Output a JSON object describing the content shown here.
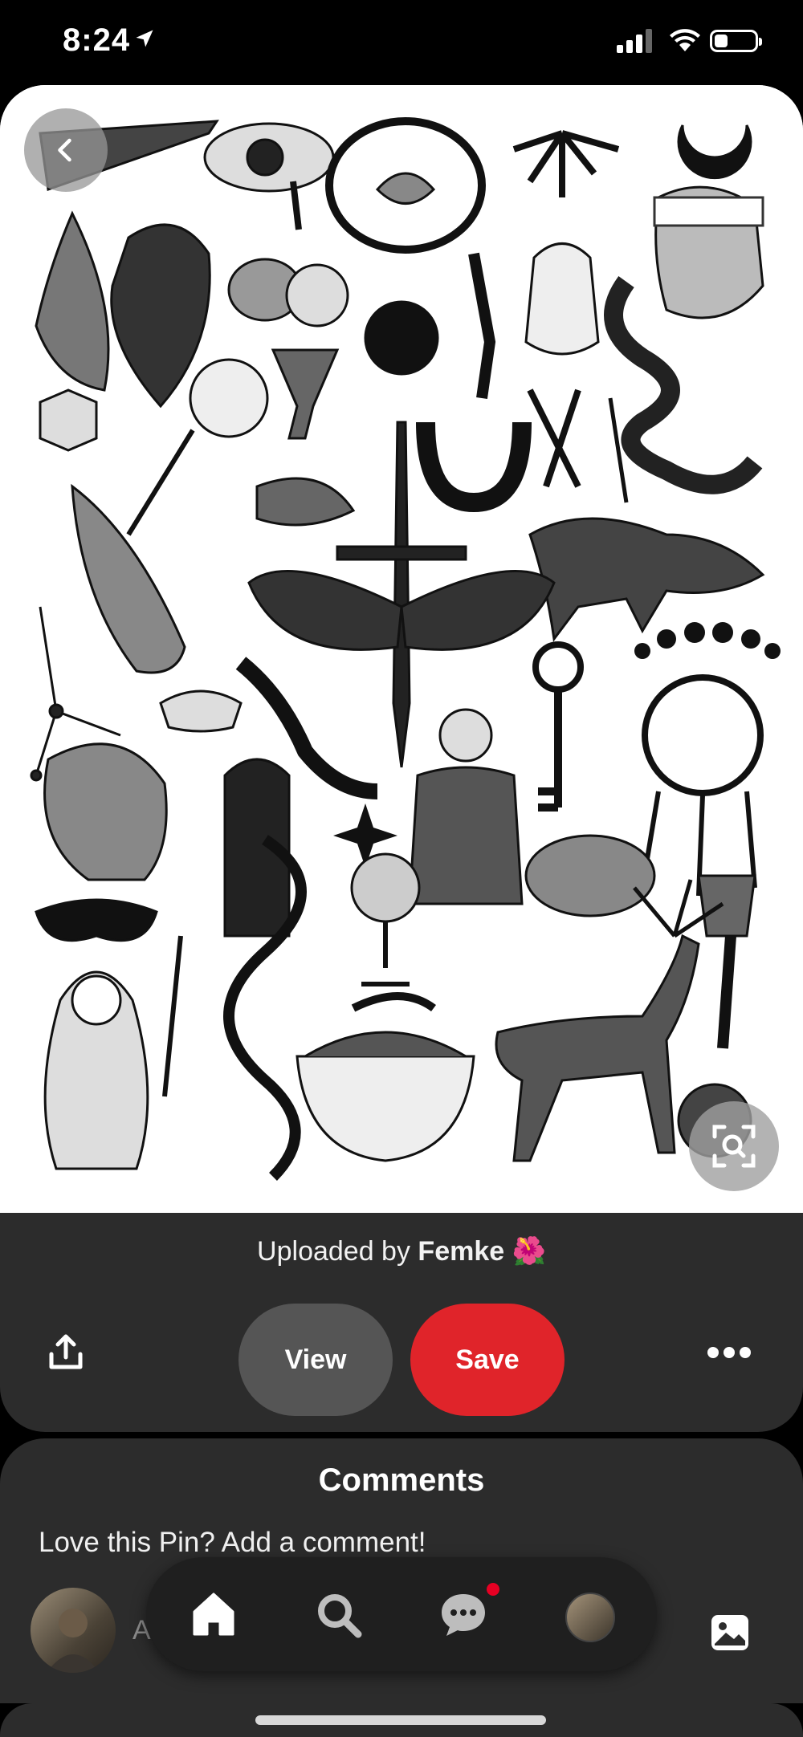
{
  "status_bar": {
    "time": "8:24"
  },
  "pin": {
    "uploaded_prefix": "Uploaded by",
    "uploader": "Femke",
    "uploader_emoji": "🌺"
  },
  "actions": {
    "view_label": "View",
    "save_label": "Save"
  },
  "comments": {
    "title": "Comments",
    "prompt": "Love this Pin? Add a comment!",
    "input_partial": "A"
  },
  "nav": {
    "messages_has_notification": true
  },
  "colors": {
    "save": "#e0242a",
    "panel": "#2c2c2c",
    "notification": "#e60023"
  }
}
